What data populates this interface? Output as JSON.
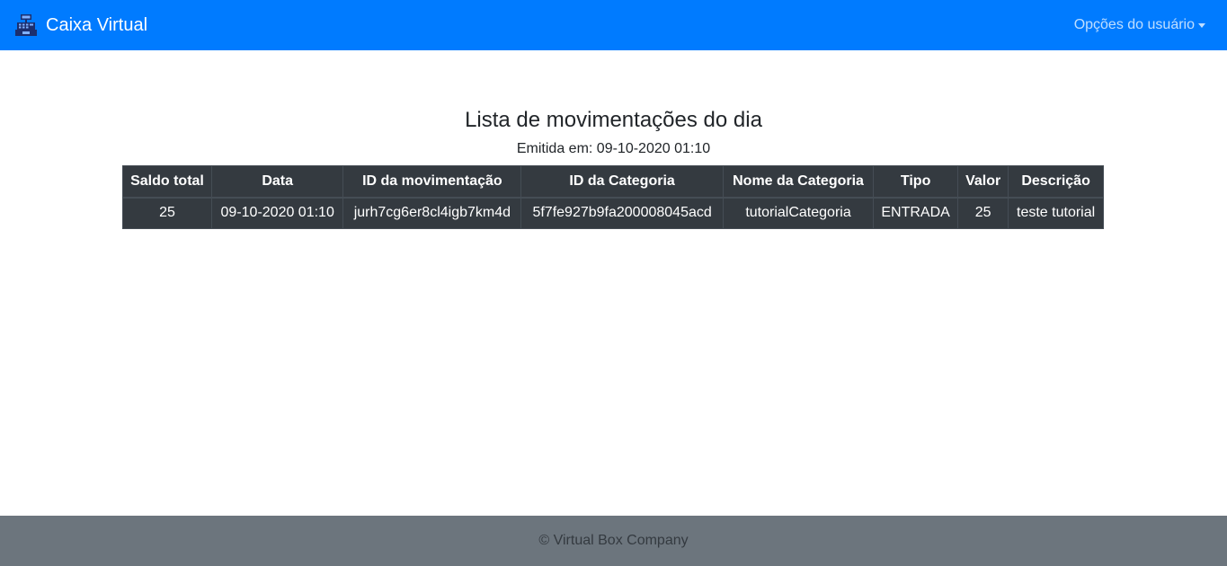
{
  "navbar": {
    "brand": "Caixa Virtual",
    "brand_icon": "cash-register-icon",
    "user_menu_label": "Opções do usuário"
  },
  "main": {
    "title": "Lista de movimentações do dia",
    "emitted": "Emitida em: 09-10-2020 01:10"
  },
  "table": {
    "headers": [
      "Saldo total",
      "Data",
      "ID da movimentação",
      "ID da Categoria",
      "Nome da Categoria",
      "Tipo",
      "Valor",
      "Descrição"
    ],
    "rows": [
      [
        "25",
        "09-10-2020 01:10",
        "jurh7cg6er8cl4igb7km4d",
        "5f7fe927b9fa200008045acd",
        "tutorialCategoria",
        "ENTRADA",
        "25",
        "teste tutorial"
      ]
    ]
  },
  "footer": {
    "text": "© Virtual Box Company"
  },
  "colors": {
    "navbar": "#007bff",
    "table_dark": "#343a40",
    "footer": "#6c757d"
  }
}
